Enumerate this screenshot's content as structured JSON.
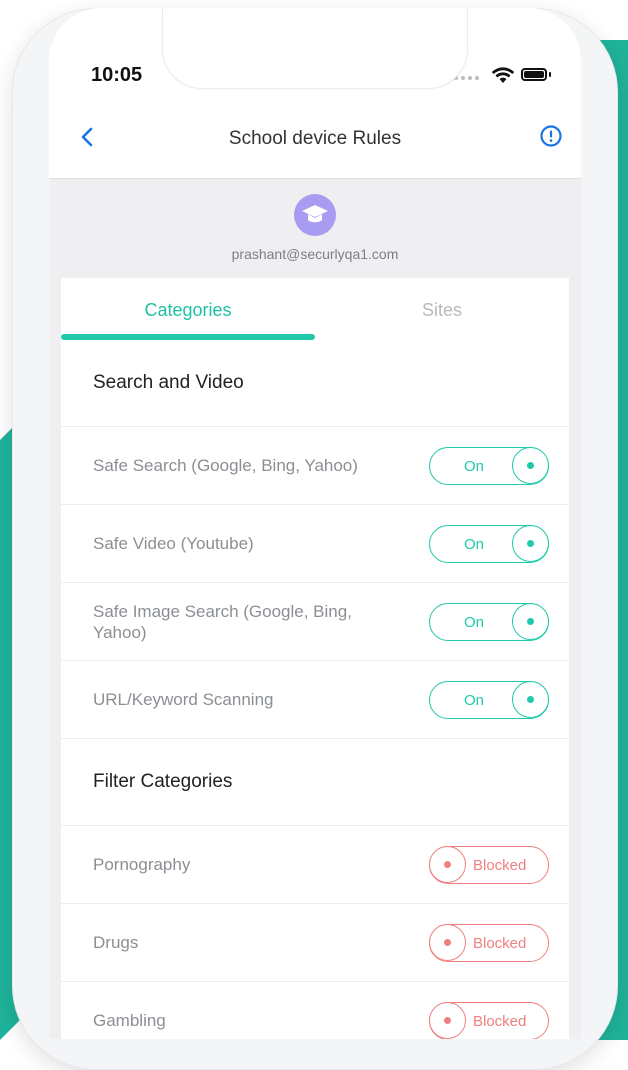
{
  "status_bar": {
    "time": "10:05"
  },
  "nav": {
    "title": "School device Rules",
    "back_icon": "chevron-left-icon",
    "info_icon": "alert-circle-icon"
  },
  "profile": {
    "email": "prashant@securlyqa1.com",
    "avatar_icon": "graduation-cap-icon"
  },
  "tabs": [
    {
      "label": "Categories",
      "active": true
    },
    {
      "label": "Sites",
      "active": false
    }
  ],
  "sections": [
    {
      "title": "Search and Video",
      "rows": [
        {
          "label": "Safe Search (Google, Bing, Yahoo)",
          "state": "On"
        },
        {
          "label": "Safe Video (Youtube)",
          "state": "On"
        },
        {
          "label": "Safe Image Search (Google, Bing, Yahoo)",
          "state": "On"
        },
        {
          "label": "URL/Keyword Scanning",
          "state": "On"
        }
      ]
    },
    {
      "title": "Filter Categories",
      "rows": [
        {
          "label": "Pornography",
          "state": "Blocked"
        },
        {
          "label": "Drugs",
          "state": "Blocked"
        },
        {
          "label": "Gambling",
          "state": "Blocked"
        }
      ]
    }
  ],
  "colors": {
    "accent": "#1fc9aa",
    "blocked": "#f08080",
    "link": "#1a73e8",
    "avatar": "#a79cf2"
  }
}
